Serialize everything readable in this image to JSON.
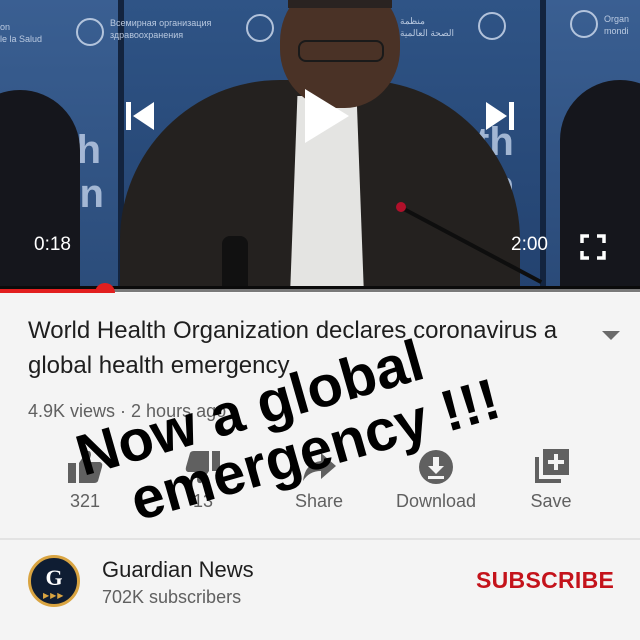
{
  "player": {
    "time_current": "0:18",
    "time_total": "2:00",
    "progress": 0.15,
    "accent_color": "#e21f1f",
    "icons": [
      "previous-icon",
      "play-icon",
      "next-icon",
      "fullscreen-icon"
    ],
    "background": {
      "left_text_1": "on",
      "left_text_2": "le la Salud",
      "left_big_1": "alth",
      "left_big_2": "ion",
      "center_text_1": "Всемирная организация",
      "center_text_2": "здравоохранения",
      "right_text_1": "منظمة",
      "right_text_2": "الصحة العالمية",
      "right_big_1": "th",
      "right_big_2": "n",
      "far_right_text_1": "Organ",
      "far_right_text_2": "mondi"
    }
  },
  "video": {
    "title": "World Health Organization declares coronavirus a global health emergency",
    "meta": "4.9K views · 2 hours ago"
  },
  "actions": {
    "like_label": "321",
    "dislike_label": "13",
    "share_label": "Share",
    "download_label": "Download",
    "save_label": "Save"
  },
  "channel": {
    "name": "Guardian News",
    "subscribers": "702K subscribers",
    "avatar_letter": "G",
    "avatar_dots": "▶▶▶",
    "subscribe_label": "SUBSCRIBE",
    "subscribe_color": "#c4131b"
  },
  "overlay": {
    "line1": "Now a global",
    "line2": "emergency !!!"
  }
}
